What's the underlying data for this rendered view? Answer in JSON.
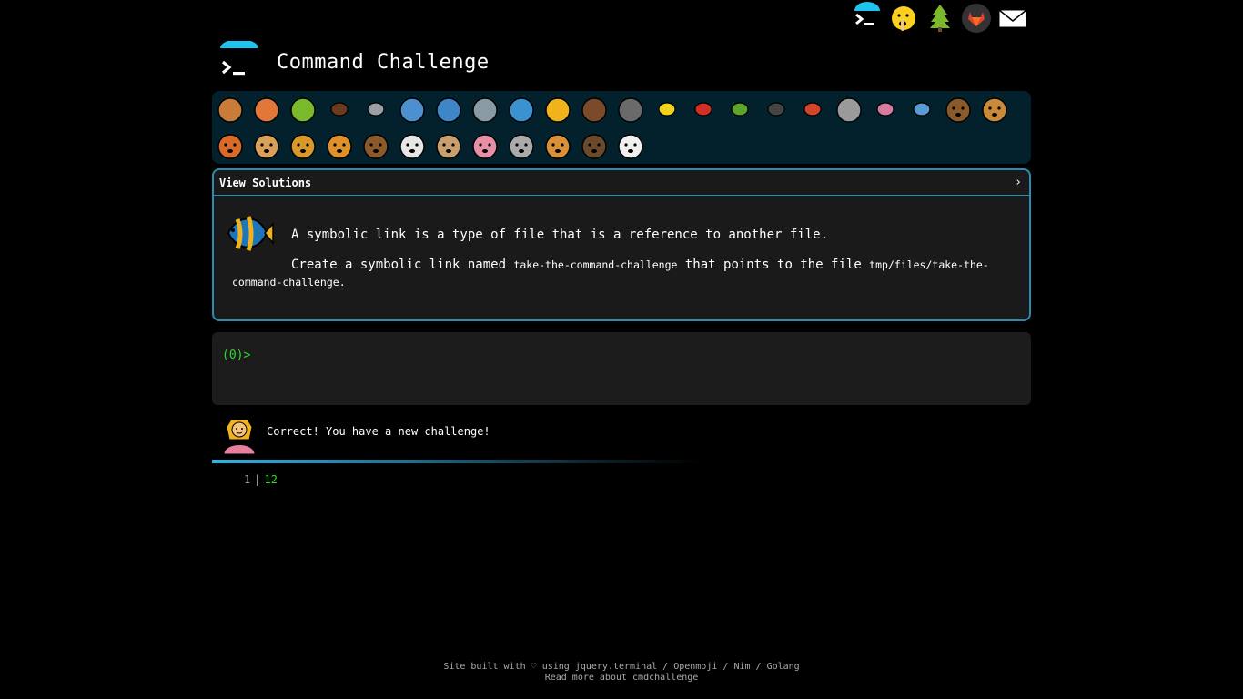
{
  "header": {
    "title": "Command Challenge"
  },
  "top_icons": [
    "terminal-icon",
    "shushing-face-icon",
    "tree-icon",
    "gitlab-icon",
    "envelope-icon"
  ],
  "challenge_icons": [
    "snail-icon",
    "butterfly-icon",
    "caterpillar-icon",
    "ant-icon",
    "spider-web-icon",
    "whale-icon",
    "dolphin-icon",
    "shark-icon",
    "fish-icon",
    "tropical-fish-icon",
    "otter-icon",
    "wolf-icon",
    "bee-icon",
    "ladybug-icon",
    "cricket-icon",
    "spider-icon",
    "scorpion-icon",
    "fly-icon",
    "worm-icon",
    "microbe-icon",
    "monkey-icon",
    "dog-icon",
    "fox-icon",
    "cat-icon",
    "lion-icon",
    "tiger-icon",
    "horse-icon",
    "unicorn-icon",
    "cow-icon",
    "pig-icon",
    "mouse-icon",
    "hamster-icon",
    "bear-icon",
    "panda-icon"
  ],
  "solutions_panel": {
    "label": "View Solutions",
    "chevron": "›"
  },
  "challenge": {
    "icon": "tropical-fish-icon",
    "line1": "A symbolic link is a type of file that is a reference to another file.",
    "line2_prefix": "Create a symbolic link named ",
    "link_name": "take-the-command-challenge",
    "line2_middle": " that points to the file ",
    "target_path": "tmp/files/take-the-command-challenge",
    "line2_suffix": "."
  },
  "terminal": {
    "prompt": "(0)>"
  },
  "result": {
    "message": "Correct! You have a new challenge!",
    "progress": 0.6
  },
  "score": {
    "solved": "1",
    "total": "12"
  },
  "footer": {
    "prefix": "Site built with ",
    "heart": "♡",
    "using": " using ",
    "link1": "jquery.terminal",
    "link2": "Openmoji",
    "link3": "Nim",
    "link4": "Golang",
    "slash": " / ",
    "line2": "Read more about cmdchallenge"
  },
  "colors": {
    "accent": "#2a8cb0",
    "bar_bg": "#02212c",
    "prompt_green": "#2ed82e"
  }
}
